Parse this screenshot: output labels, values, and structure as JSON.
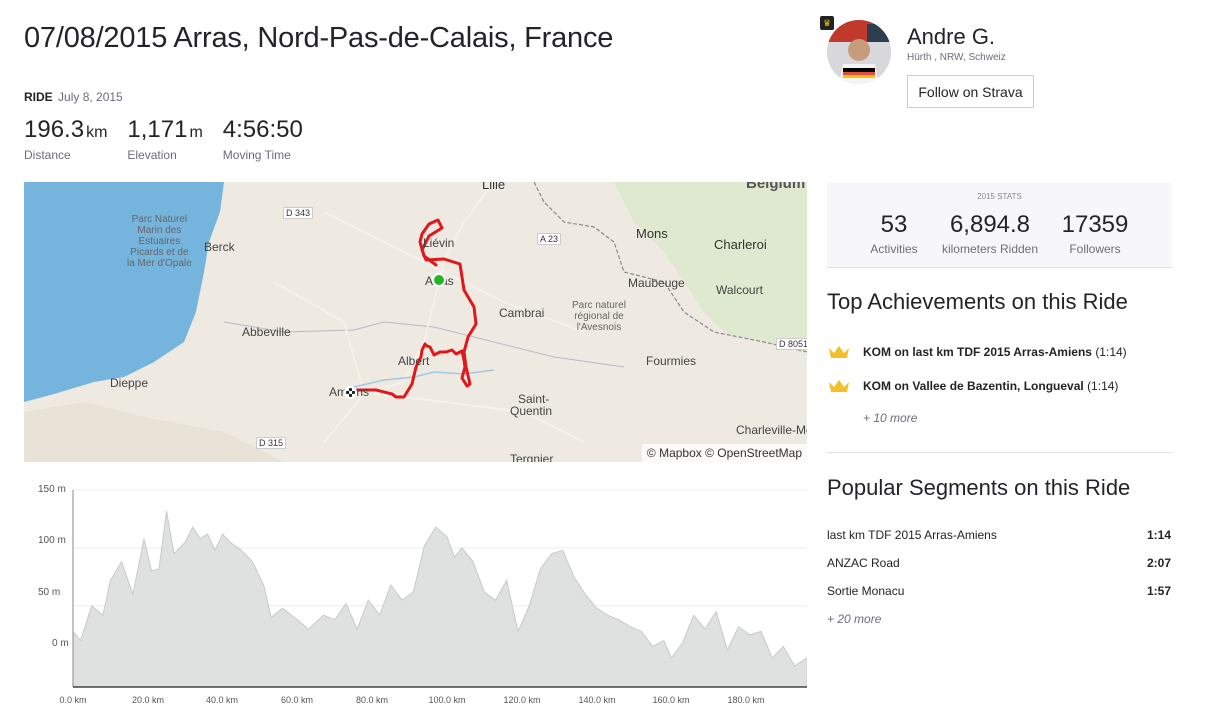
{
  "activity": {
    "title": "07/08/2015 Arras, Nord-Pas-de-Calais, France",
    "type": "RIDE",
    "date": "July 8, 2015",
    "stats": [
      {
        "value": "196.3",
        "unit": "km",
        "label": "Distance"
      },
      {
        "value": "1,171",
        "unit": "m",
        "label": "Elevation"
      },
      {
        "value": "4:56:50",
        "unit": "",
        "label": "Moving Time"
      }
    ]
  },
  "map": {
    "attribution": "© Mapbox © OpenStreetMap",
    "labels": {
      "lille": "Lille",
      "belgium": "Belgium",
      "lievin": "Liévin",
      "arras": "Arras",
      "berck": "Berck",
      "mons": "Mons",
      "charleroi": "Charleroi",
      "maubeuge": "Maubeuge",
      "walcourt": "Walcourt",
      "cambrai": "Cambrai",
      "abbeville": "Abbeville",
      "albert": "Albert",
      "fourmies": "Fourmies",
      "dieppe": "Dieppe",
      "amiens": "Amiens",
      "saint_quentin_1": "Saint-",
      "saint_quentin_2": "Quentin",
      "charleville": "Charleville-Mé",
      "tergnier": "Tergnier",
      "parc_marin": "Parc Naturel\nMarin des\nEstuaires\nPicards et de\nla Mer d'Opale",
      "parc_avesnois": "Parc naturel\nrégional de\nl'Avesnois",
      "road_d343": "D 343",
      "road_a23": "A 23",
      "road_d315": "D 315",
      "road_d8051": "D 8051"
    },
    "route_color": "#e0171b",
    "start_color": "#22b624"
  },
  "elevation": {
    "y_labels": [
      "150 m",
      "100 m",
      "50 m",
      "0 m"
    ],
    "x_labels": [
      "0.0 km",
      "20.0 km",
      "40.0 km",
      "60.0 km",
      "80.0 km",
      "100.0 km",
      "120.0 km",
      "140.0 km",
      "160.0 km",
      "180.0 km"
    ]
  },
  "chart_data": {
    "type": "area",
    "title": "",
    "xlabel": "",
    "ylabel": "",
    "xlim": [
      0,
      196.3
    ],
    "ylim": [
      -20,
      150
    ],
    "x": [
      0,
      2,
      5,
      8,
      10,
      13,
      16,
      19,
      21,
      23,
      25,
      27,
      30,
      32,
      34,
      36,
      38,
      40,
      42,
      45,
      48,
      51,
      53,
      56,
      60,
      63,
      67,
      70,
      73,
      76,
      79,
      82,
      85,
      88,
      91,
      94,
      97,
      100,
      102,
      104,
      107,
      110,
      113,
      116,
      119,
      122,
      125,
      128,
      131,
      134,
      137,
      140,
      143,
      146,
      149,
      152,
      155,
      158,
      160,
      163,
      166,
      169,
      172,
      175,
      178,
      181,
      184,
      187,
      190,
      193,
      196.3
    ],
    "y": [
      28,
      20,
      50,
      42,
      72,
      88,
      60,
      108,
      80,
      82,
      132,
      95,
      105,
      118,
      108,
      112,
      98,
      112,
      105,
      98,
      88,
      68,
      40,
      48,
      38,
      30,
      42,
      38,
      52,
      30,
      55,
      42,
      68,
      55,
      62,
      102,
      118,
      110,
      92,
      100,
      88,
      62,
      55,
      72,
      28,
      50,
      82,
      95,
      98,
      75,
      60,
      48,
      42,
      38,
      32,
      28,
      15,
      20,
      5,
      18,
      42,
      30,
      45,
      12,
      32,
      25,
      28,
      5,
      15,
      -2,
      5
    ],
    "series": [
      {
        "values_ref": "y"
      }
    ]
  },
  "profile": {
    "name": "Andre G.",
    "location": "Hürth , NRW, Schweiz",
    "follow_label": "Follow on Strava"
  },
  "year_stats": {
    "header": "2015 STATS",
    "items": [
      {
        "value": "53",
        "label": "Activities"
      },
      {
        "value": "6,894.8",
        "label": "kilometers Ridden"
      },
      {
        "value": "17359",
        "label": "Followers"
      }
    ]
  },
  "achievements": {
    "title": "Top Achievements on this Ride",
    "items": [
      {
        "name": "KOM on last km TDF 2015 Arras-Amiens",
        "time": "(1:14)"
      },
      {
        "name": "KOM on Vallee de Bazentin, Longueval",
        "time": "(1:14)"
      }
    ],
    "more": "+ 10 more"
  },
  "segments": {
    "title": "Popular Segments on this Ride",
    "items": [
      {
        "name": "last km TDF 2015 Arras-Amiens",
        "time": "1:14"
      },
      {
        "name": "ANZAC Road",
        "time": "2:07"
      },
      {
        "name": "Sortie Monacu",
        "time": "1:57"
      }
    ],
    "more": "+ 20 more"
  }
}
